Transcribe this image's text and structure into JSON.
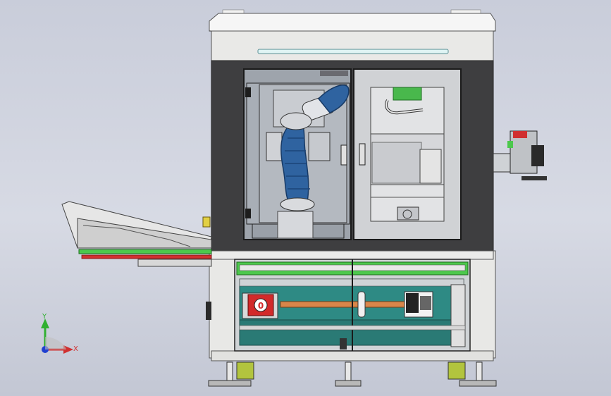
{
  "viewport": {
    "background_top": "#c9cdda",
    "background_bottom": "#c3c7d4"
  },
  "model": {
    "frame_color": "#e8e8e6",
    "panel_color": "#3e3e40",
    "glass_color": "#a2a7ae",
    "robot_color": "#2f63a0",
    "base_color": "#2e8a84",
    "accent_green": "#4cc84c",
    "accent_red": "#d03030",
    "estop_label": "0"
  },
  "triad": {
    "x_label": "X",
    "y_label": "Y",
    "x_color": "#d03030",
    "y_color": "#30b030",
    "z_color": "#2040d0"
  }
}
